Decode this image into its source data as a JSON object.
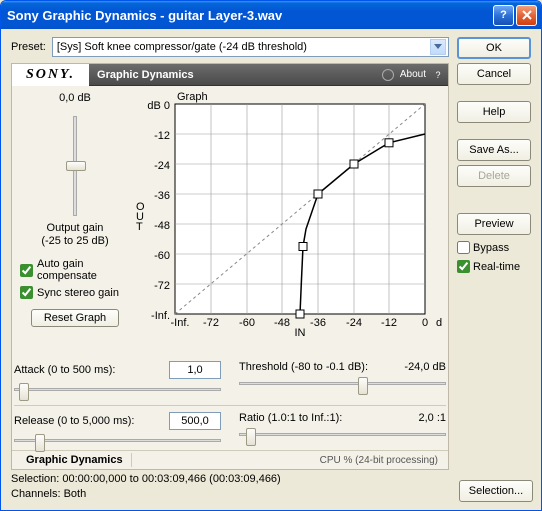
{
  "window": {
    "title": "Sony Graphic Dynamics - guitar Layer-3.wav"
  },
  "preset": {
    "label": "Preset:",
    "value": "[Sys] Soft knee compressor/gate (-24 dB threshold)"
  },
  "brand": "SONY.",
  "panel_title": "Graphic Dynamics",
  "about": "About",
  "gain": {
    "value": "0,0 dB",
    "label_line1": "Output gain",
    "label_line2": "(-25 to 25 dB)"
  },
  "checks": {
    "auto": "Auto gain compensate",
    "sync": "Sync stereo gain"
  },
  "reset_btn": "Reset Graph",
  "graph": {
    "title": "Graph",
    "out_label": "OUT",
    "in_label": "IN",
    "y_ticks": [
      "dB 0",
      "-12",
      "-24",
      "-36",
      "-48",
      "-60",
      "-72",
      "-Inf."
    ],
    "x_ticks": [
      "-Inf.",
      "-72",
      "-60",
      "-48",
      "-36",
      "-24",
      "-12",
      "0",
      "dB"
    ]
  },
  "params": {
    "attack": {
      "label": "Attack (0 to 500 ms):",
      "value": "1,0"
    },
    "threshold": {
      "label": "Threshold (-80 to -0.1 dB):",
      "value": "-24,0 dB"
    },
    "release": {
      "label": "Release (0 to 5,000 ms):",
      "value": "500,0"
    },
    "ratio": {
      "label": "Ratio (1.0:1 to Inf.:1):",
      "value": "2,0 :1"
    }
  },
  "footer": {
    "tab": "Graphic Dynamics",
    "cpu": "CPU %  (24-bit processing)"
  },
  "buttons": {
    "ok": "OK",
    "cancel": "Cancel",
    "help": "Help",
    "save_as": "Save As...",
    "delete": "Delete",
    "preview": "Preview",
    "bypass": "Bypass",
    "realtime": "Real-time",
    "selection": "Selection..."
  },
  "selection": {
    "line1": "Selection:   00:00:00,000 to 00:03:09,466 (00:03:09,466)",
    "line2": "Channels:  Both"
  },
  "chart_data": {
    "type": "line",
    "title": "Graph",
    "xlabel": "IN",
    "ylabel": "OUT",
    "x_ticks": [
      -72,
      -60,
      -48,
      -36,
      -24,
      -12,
      0
    ],
    "y_ticks": [
      0,
      -12,
      -24,
      -36,
      -48,
      -60,
      -72
    ],
    "xlim": [
      -84,
      0
    ],
    "ylim": [
      -84,
      0
    ],
    "series": [
      {
        "name": "identity",
        "style": "dashed",
        "x": [
          -84,
          0
        ],
        "y": [
          -84,
          0
        ]
      },
      {
        "name": "curve",
        "style": "solid",
        "x": [
          -42,
          -41.5,
          -41,
          -40,
          -36,
          -24,
          -12,
          0
        ],
        "y": [
          -84,
          -70,
          -57,
          -50,
          -36,
          -24,
          -15.5,
          -12
        ]
      }
    ],
    "handles": [
      {
        "x": -42,
        "y": -84
      },
      {
        "x": -41,
        "y": -57
      },
      {
        "x": -36,
        "y": -36
      },
      {
        "x": -24,
        "y": -24
      },
      {
        "x": -12,
        "y": -15.5
      }
    ]
  }
}
